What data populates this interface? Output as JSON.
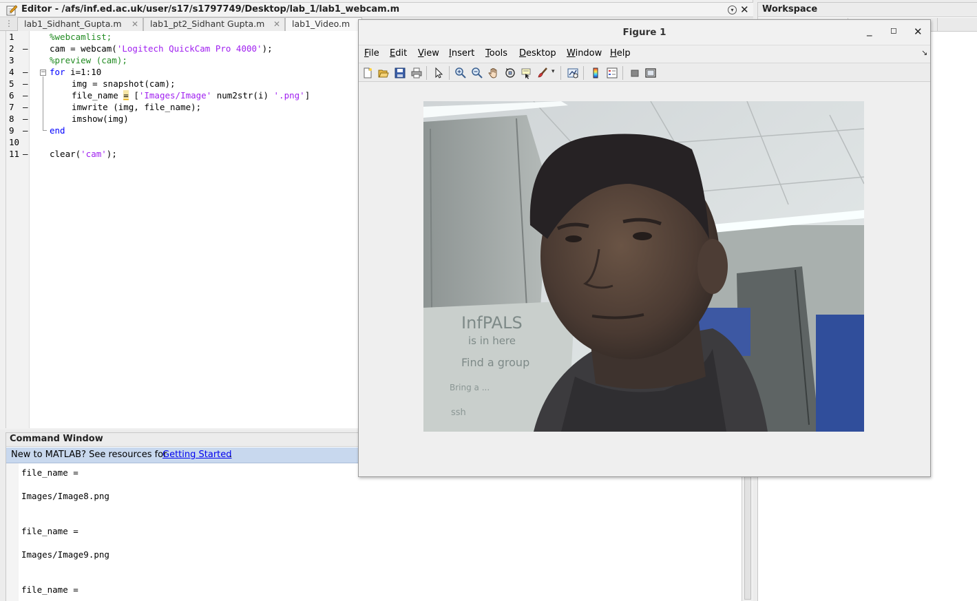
{
  "editor": {
    "title": "Editor - /afs/inf.ed.ac.uk/user/s17/s1797749/Desktop/lab_1/lab1_webcam.m",
    "tabs": [
      {
        "label": "lab1_Sidhant_Gupta.m"
      },
      {
        "label": "lab1_pt2_Sidhant Gupta.m"
      },
      {
        "label": "lab1_Video.m"
      }
    ],
    "line_numbers": [
      "1",
      "2",
      "3",
      "4",
      "5",
      "6",
      "7",
      "8",
      "9",
      "10",
      "11"
    ],
    "code": {
      "l1": "%webcamlist;",
      "l2_a": "cam = webcam(",
      "l2_s": "'Logitech QuickCam Pro 4000'",
      "l2_b": ");",
      "l3": "%preview (cam);",
      "l4_kw": "for",
      "l4_rest": " i=1:10",
      "l5": "img = snapshot(cam);",
      "l6_a": "file_name ",
      "l6_eq": "=",
      "l6_b": " [",
      "l6_s1": "'Images/Image'",
      "l6_c": " num2str(i) ",
      "l6_s2": "'.png'",
      "l6_d": "]",
      "l7": "imwrite (img, file_name);",
      "l8": "imshow(img)",
      "l9_kw": "end",
      "l11_a": "clear(",
      "l11_s": "'cam'",
      "l11_b": ");"
    }
  },
  "command_window": {
    "title": "Command Window",
    "banner_text": "New to MATLAB? See resources for ",
    "banner_link": "Getting Started",
    "banner_end": ".",
    "output": [
      "file_name =",
      "Images/Image8.png",
      "file_name =",
      "Images/Image9.png",
      "file_name ="
    ]
  },
  "workspace": {
    "title": "Workspace"
  },
  "figure": {
    "title": "Figure 1",
    "menu": [
      {
        "underline": "F",
        "rest": "ile"
      },
      {
        "underline": "E",
        "rest": "dit"
      },
      {
        "underline": "V",
        "rest": "iew"
      },
      {
        "underline": "I",
        "rest": "nsert"
      },
      {
        "underline": "T",
        "rest": "ools"
      },
      {
        "underline": "D",
        "rest": "esktop"
      },
      {
        "underline": "W",
        "rest": "indow"
      },
      {
        "underline": "H",
        "rest": "elp"
      }
    ],
    "toolbar_icons": [
      "new-figure-icon",
      "open-file-icon",
      "save-icon",
      "print-icon",
      "pointer-icon",
      "zoom-in-icon",
      "zoom-out-icon",
      "pan-icon",
      "rotate-3d-icon",
      "data-cursor-icon",
      "brush-icon",
      "brush-dropdown-icon",
      "link-plot-icon",
      "colorbar-icon",
      "legend-icon",
      "hide-plot-tools-icon",
      "show-plot-tools-icon"
    ],
    "whiteboard_text": [
      "InfPALS",
      "is in here",
      "Find a group",
      "Bring a ...",
      "ssh"
    ],
    "image": "webcam snapshot of a person in an office"
  },
  "colors": {
    "keyword": "#0000ff",
    "comment": "#228b22",
    "string": "#a020f0",
    "banner": "#c8d8ee",
    "link": "#0000ee"
  }
}
